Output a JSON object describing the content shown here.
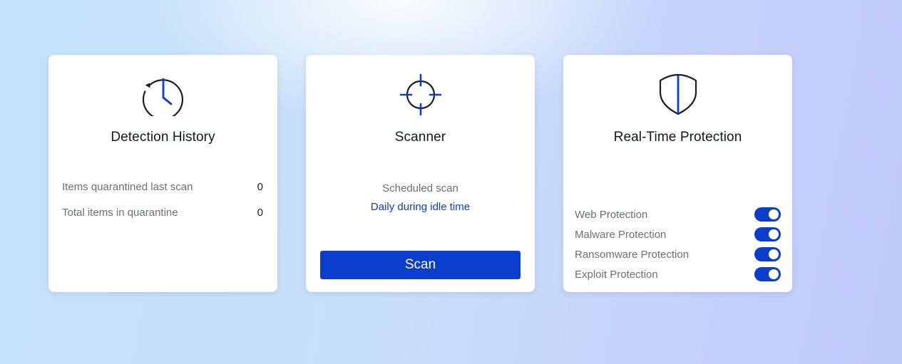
{
  "colors": {
    "accent": "#0b3ecc",
    "link_text": "#0d3ec6",
    "muted_text": "#6b6f78",
    "title_text": "#111826",
    "card_background": "#ffffff"
  },
  "detection_history": {
    "icon": "history-clock-icon",
    "title": "Detection History",
    "stats": [
      {
        "label": "Items quarantined last scan",
        "value": "0"
      },
      {
        "label": "Total items in quarantine",
        "value": "0"
      }
    ]
  },
  "scanner": {
    "icon": "crosshair-icon",
    "title": "Scanner",
    "schedule_label": "Scheduled scan",
    "schedule_value": "Daily during idle time",
    "scan_button_label": "Scan"
  },
  "real_time_protection": {
    "icon": "shield-icon",
    "title": "Real-Time Protection",
    "items": [
      {
        "label": "Web Protection",
        "enabled": true
      },
      {
        "label": "Malware Protection",
        "enabled": true
      },
      {
        "label": "Ransomware Protection",
        "enabled": true
      },
      {
        "label": "Exploit Protection",
        "enabled": true
      }
    ]
  }
}
